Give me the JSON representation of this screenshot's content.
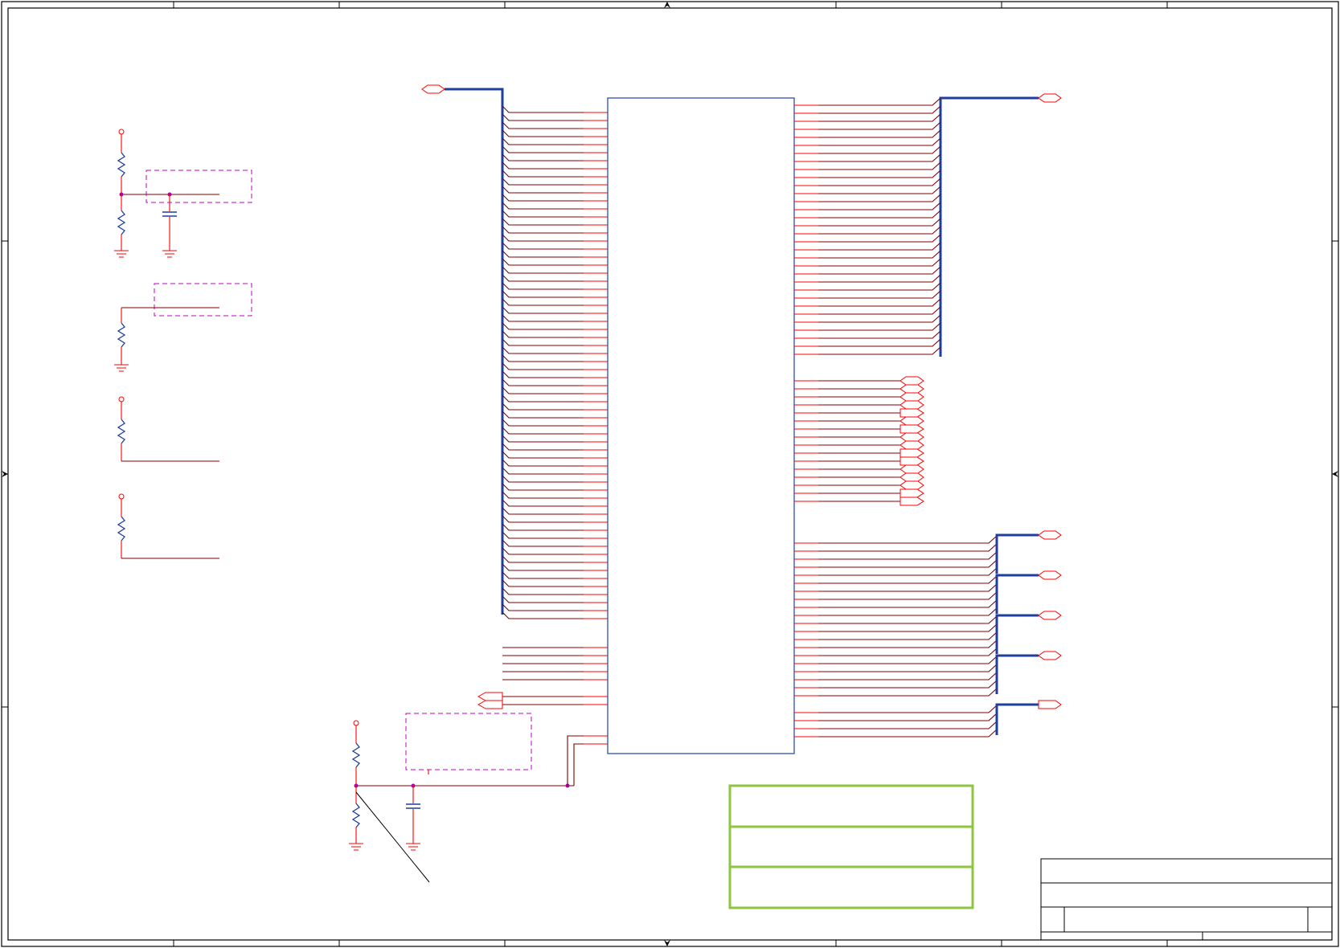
{
  "sheet": {
    "description": ""
  },
  "colors": {
    "wire": "#800000",
    "pin": "#ff0000",
    "bus": "#1f3f9f",
    "note_box": "#c000c0",
    "info_box": "#8cc63f"
  }
}
